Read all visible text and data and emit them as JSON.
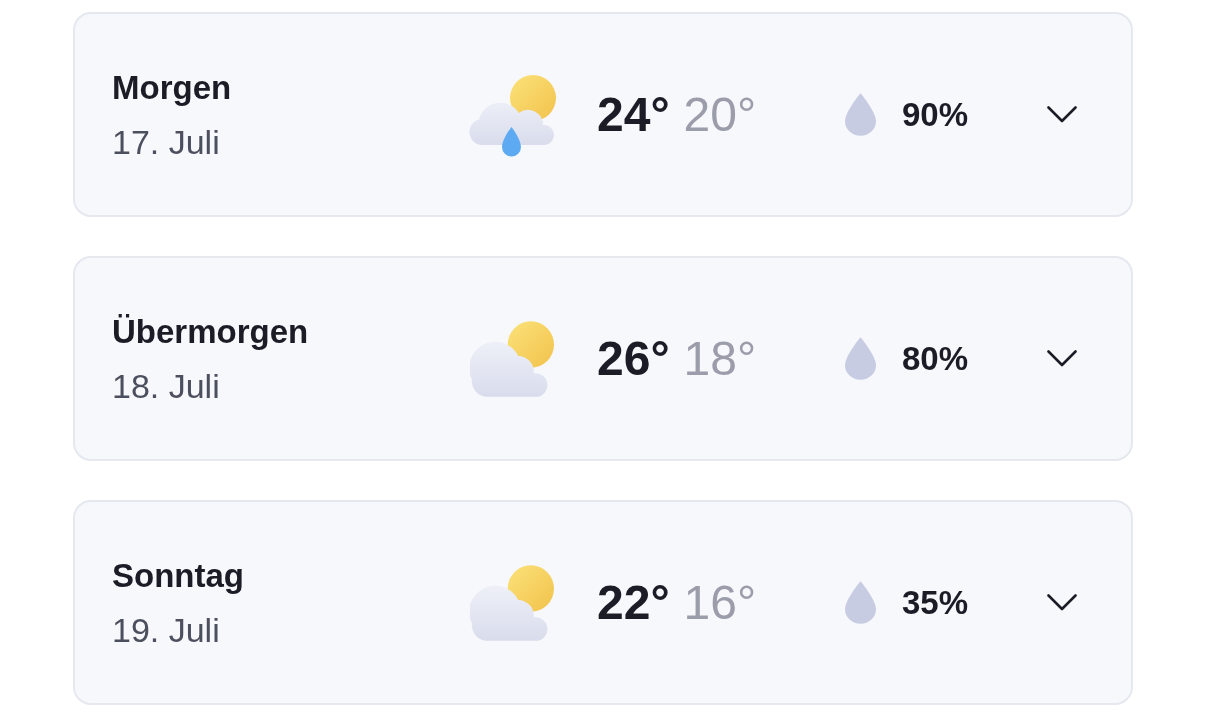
{
  "forecast": [
    {
      "day": "Morgen",
      "date": "17. Juli",
      "kind": "rain",
      "high": "24°",
      "low": "20°",
      "precipitation": "90%",
      "expanded": false
    },
    {
      "day": "Übermorgen",
      "date": "18. Juli",
      "kind": "partly_cloudy",
      "high": "26°",
      "low": "18°",
      "precipitation": "80%",
      "expanded": false
    },
    {
      "day": "Sonntag",
      "date": "19. Juli",
      "kind": "partly_cloudy",
      "high": "22°",
      "low": "16°",
      "precipitation": "35%",
      "expanded": false
    }
  ]
}
